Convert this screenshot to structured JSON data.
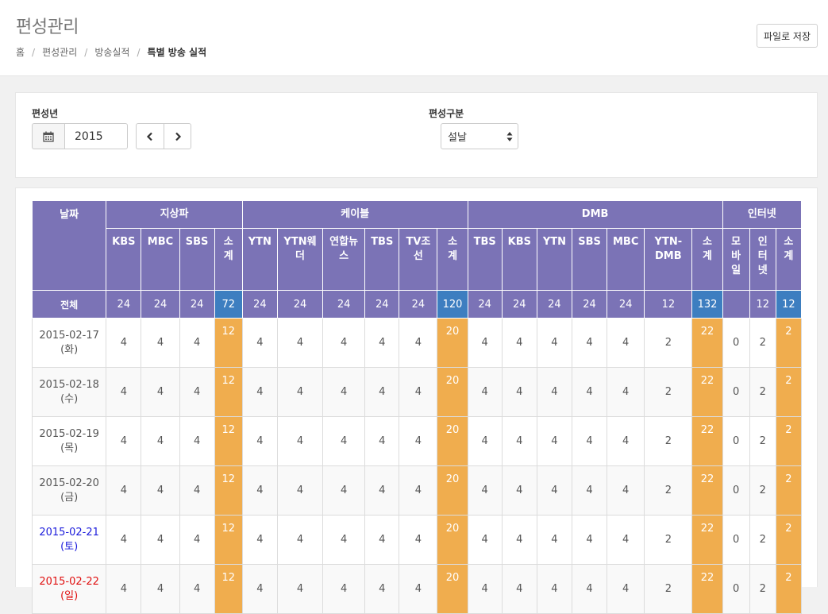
{
  "header": {
    "title": "편성관리",
    "breadcrumb": [
      "홈",
      "편성관리",
      "방송실적",
      "특별 방송 실적"
    ],
    "save_button": "파일로 저장"
  },
  "filters": {
    "year_label": "편성년",
    "year_value": "2015",
    "type_label": "편성구분",
    "type_value": "설날"
  },
  "icons": {
    "calendar": "calendar-icon",
    "prev": "chevron-left-icon",
    "next": "chevron-right-icon",
    "select": "sort-arrows-icon"
  },
  "colors": {
    "header_purple": "#7b73b6",
    "total_subtotal_blue": "#3d7ec0",
    "subtotal_orange": "#f0ad4e",
    "saturday": "#1a1adb",
    "sunday": "#e01010"
  },
  "table": {
    "date_header": "날짜",
    "groups": [
      {
        "name": "지상파",
        "columns": [
          "KBS",
          "MBC",
          "SBS",
          "소\n계"
        ]
      },
      {
        "name": "케이블",
        "columns": [
          "YTN",
          "YTN웨\n더",
          "연합뉴\n스",
          "TBS",
          "TV조\n선",
          "소\n계"
        ]
      },
      {
        "name": "DMB",
        "columns": [
          "TBS",
          "KBS",
          "YTN",
          "SBS",
          "MBC",
          "YTN-\nDMB",
          "소\n계"
        ]
      },
      {
        "name": "인터넷",
        "columns": [
          "모\n바\n일",
          "인\n터\n넷",
          "소\n계"
        ]
      }
    ],
    "total_row": {
      "label": "전체",
      "values": [
        "24",
        "24",
        "24",
        "72",
        "24",
        "24",
        "24",
        "24",
        "24",
        "120",
        "24",
        "24",
        "24",
        "24",
        "24",
        "12",
        "132",
        "",
        "12",
        "12"
      ]
    },
    "rows": [
      {
        "date": "2015-02-17",
        "weekday": "(화)",
        "values": [
          "4",
          "4",
          "4",
          "12",
          "4",
          "4",
          "4",
          "4",
          "4",
          "20",
          "4",
          "4",
          "4",
          "4",
          "4",
          "2",
          "22",
          "0",
          "2",
          "2"
        ]
      },
      {
        "date": "2015-02-18",
        "weekday": "(수)",
        "values": [
          "4",
          "4",
          "4",
          "12",
          "4",
          "4",
          "4",
          "4",
          "4",
          "20",
          "4",
          "4",
          "4",
          "4",
          "4",
          "2",
          "22",
          "0",
          "2",
          "2"
        ]
      },
      {
        "date": "2015-02-19",
        "weekday": "(목)",
        "values": [
          "4",
          "4",
          "4",
          "12",
          "4",
          "4",
          "4",
          "4",
          "4",
          "20",
          "4",
          "4",
          "4",
          "4",
          "4",
          "2",
          "22",
          "0",
          "2",
          "2"
        ]
      },
      {
        "date": "2015-02-20",
        "weekday": "(금)",
        "values": [
          "4",
          "4",
          "4",
          "12",
          "4",
          "4",
          "4",
          "4",
          "4",
          "20",
          "4",
          "4",
          "4",
          "4",
          "4",
          "2",
          "22",
          "0",
          "2",
          "2"
        ]
      },
      {
        "date": "2015-02-21",
        "weekday": "(토)",
        "values": [
          "4",
          "4",
          "4",
          "12",
          "4",
          "4",
          "4",
          "4",
          "4",
          "20",
          "4",
          "4",
          "4",
          "4",
          "4",
          "2",
          "22",
          "0",
          "2",
          "2"
        ]
      },
      {
        "date": "2015-02-22",
        "weekday": "(일)",
        "values": [
          "4",
          "4",
          "4",
          "12",
          "4",
          "4",
          "4",
          "4",
          "4",
          "20",
          "4",
          "4",
          "4",
          "4",
          "4",
          "2",
          "22",
          "0",
          "2",
          "2"
        ]
      }
    ]
  }
}
